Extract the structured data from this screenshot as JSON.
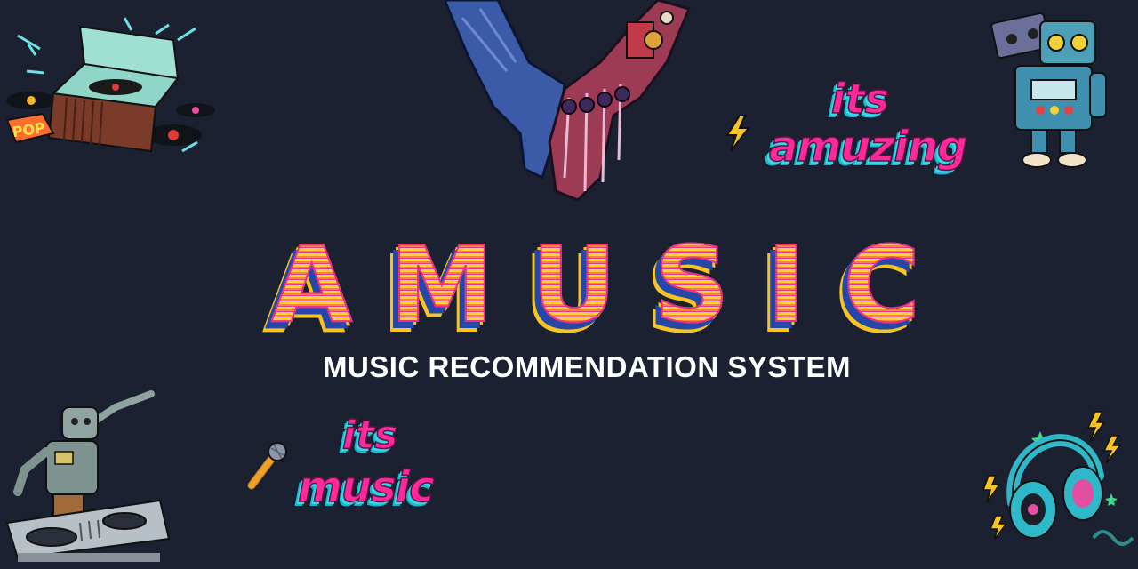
{
  "title": "AMUSIC",
  "subtitle": "MUSIC RECOMMENDATION SYSTEM",
  "stickers": {
    "top_right_line1": "its",
    "top_right_line2": "amuzing",
    "bottom_left_line1": "its",
    "bottom_left_line2": "music"
  },
  "title_letters": [
    "A",
    "M",
    "U",
    "S",
    "I",
    "C"
  ],
  "illustrations": {
    "top_left": "record-player-icon",
    "top_center": "human-robot-hands-icon",
    "top_right": "cassette-robot-icon",
    "bottom_left": "robot-dj-icon",
    "bottom_right": "headphones-icon",
    "lightning": "lightning-icon",
    "microphone": "microphone-icon"
  },
  "colors": {
    "background": "#1b2131",
    "title_yellow": "#ffd43b",
    "title_pink": "#ea2f86",
    "title_blue": "#2547a8",
    "sticker_pink": "#ff2a9a",
    "sticker_cyan": "#35d7e8"
  }
}
